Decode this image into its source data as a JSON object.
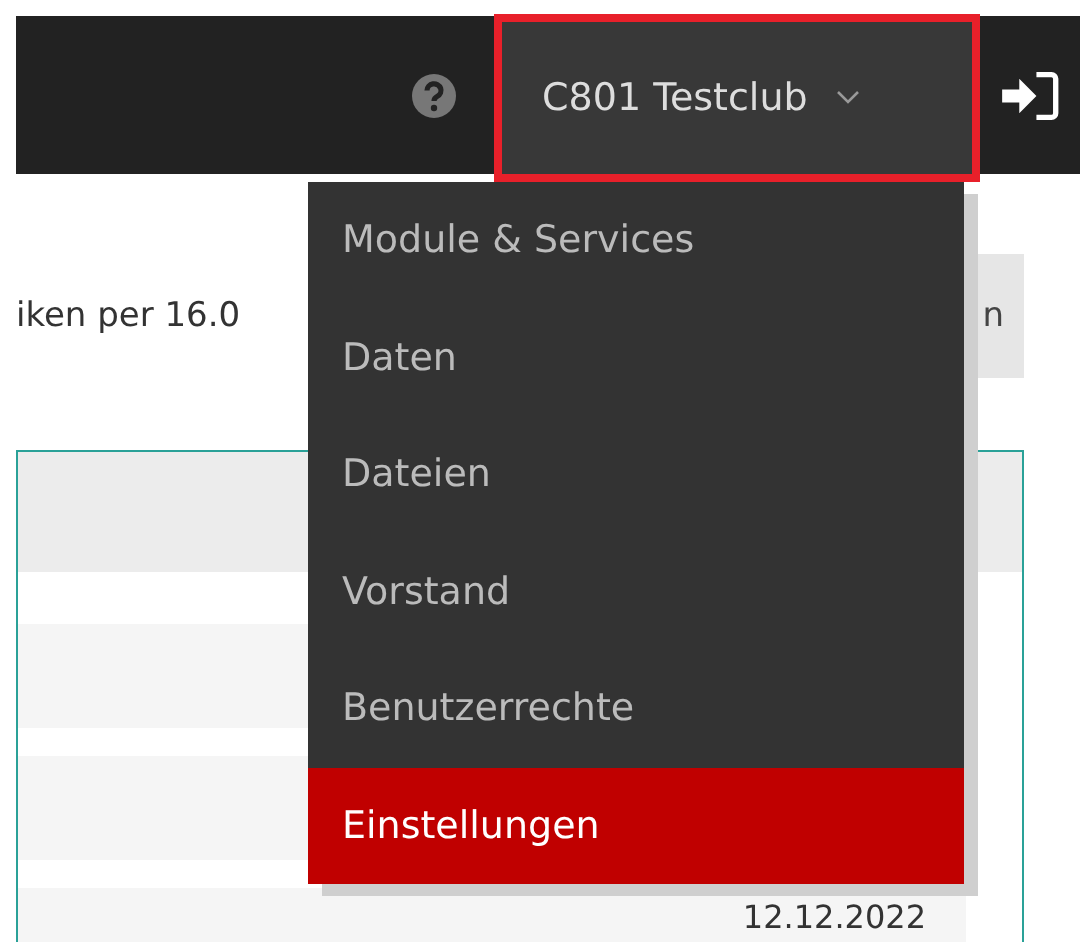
{
  "navbar": {
    "club_button": {
      "label": "C801 Testclub",
      "highlighted": true
    }
  },
  "page": {
    "intro_text": "iken per  16.0",
    "action_button": "n",
    "table": {
      "rows": [
        {
          "cells": []
        },
        {
          "cells": []
        },
        {
          "cells": [
            "12.12.2022"
          ]
        }
      ]
    }
  },
  "dropdown": {
    "items": [
      {
        "label": "Module & Services",
        "selected": false
      },
      {
        "label": "Daten",
        "selected": false
      },
      {
        "label": "Dateien",
        "selected": false
      },
      {
        "label": "Vorstand",
        "selected": false
      },
      {
        "label": "Benutzerrechte",
        "selected": false
      },
      {
        "label": "Einstellungen",
        "selected": true
      }
    ]
  }
}
